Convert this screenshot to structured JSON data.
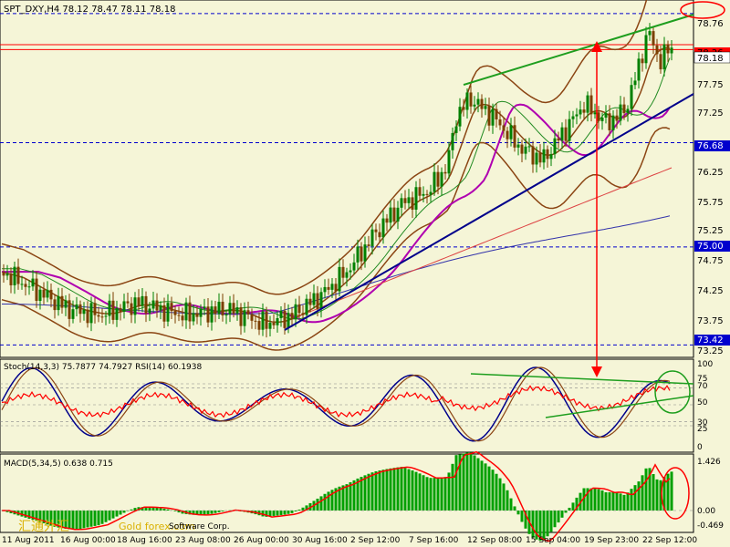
{
  "main": {
    "header": "SPT_DXY,H4  78.12 78.47 78.11 78.18",
    "yaxis": [
      "78.76",
      "78.26",
      "78.18",
      "77.75",
      "77.25",
      "76.68",
      "76.25",
      "75.75",
      "75.25",
      "75.00",
      "74.75",
      "74.25",
      "73.75",
      "73.42",
      "73.25"
    ],
    "xaxis": [
      "11 Aug 2011",
      "16 Aug 00:00",
      "18 Aug 16:00",
      "23 Aug 08:00",
      "26 Aug 00:00",
      "30 Aug 16:00",
      "2 Sep 12:00",
      "7 Sep 16:00",
      "12 Sep 08:00",
      "15 Sep 04:00",
      "19 Sep 23:00",
      "22 Sep 12:00"
    ]
  },
  "stoch": {
    "header": "Stoch(14,3,3) 75.7877 74.7927  RSI(14) 60.1938",
    "yaxis": [
      "100",
      "75",
      "70",
      "50",
      "30",
      "25",
      "0"
    ]
  },
  "macd": {
    "header": "MACD(5,34,5) 0.638 0.715",
    "yaxis": [
      "1.426",
      "0.00",
      "-0.469"
    ]
  },
  "watermark": {
    "cn": "汇通外汇",
    "site": "Gold forex.com",
    "text": "Software Corp."
  },
  "colors": {
    "background": "#F5F5D7",
    "candle_up": "#008000",
    "candle_down": "#7B3F00",
    "bollinger": "#8B4513",
    "ma_magenta": "#B000B0",
    "trend_green": "#1E9E1E",
    "trend_blue": "#00008B",
    "level_blue": "#0000CD",
    "red": "#FF0000",
    "stoch_main": "#00008B",
    "stoch_signal": "#8B4513",
    "rsi": "#FF0000",
    "macd_hist": "#00A000"
  },
  "chart_data": {
    "type": "line",
    "symbol": "SPT_DXY,H4",
    "ohlc_last": {
      "open": 78.12,
      "high": 78.47,
      "low": 78.11,
      "close": 78.18
    },
    "x": [
      "11 Aug 2011",
      "16 Aug 00:00",
      "18 Aug 16:00",
      "23 Aug 08:00",
      "26 Aug 00:00",
      "30 Aug 16:00",
      "2 Sep 12:00",
      "7 Sep 16:00",
      "12 Sep 08:00",
      "15 Sep 04:00",
      "19 Sep 23:00",
      "22 Sep 12:00"
    ],
    "series": [
      {
        "values": [
          74.6,
          74.1,
          74.2,
          74.0,
          73.8,
          73.95,
          74.8,
          75.6,
          77.3,
          76.4,
          76.9,
          78.2
        ]
      }
    ],
    "levels": [
      78.76,
      78.26,
      78.18,
      76.68,
      75.0,
      73.42
    ],
    "ylim": [
      73.25,
      78.95
    ],
    "indicators": {
      "stoch_main": 75.7877,
      "stoch_signal": 74.7927,
      "rsi": 60.1938,
      "macd_main": 0.638,
      "macd_signal": 0.715
    }
  }
}
